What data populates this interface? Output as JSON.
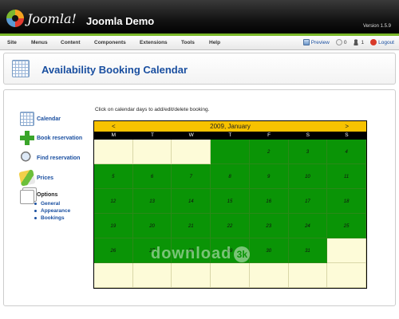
{
  "header": {
    "brand": "Joomla!",
    "site_title": "Joomla Demo",
    "version": "Version 1.5.9"
  },
  "menubar": {
    "items": [
      "Site",
      "Menus",
      "Content",
      "Components",
      "Extensions",
      "Tools",
      "Help"
    ],
    "status": {
      "preview": "Preview",
      "messages": "0",
      "users": "1",
      "logout": "Logout"
    }
  },
  "page": {
    "title": "Availability Booking Calendar"
  },
  "sidebar": {
    "items": [
      {
        "label": "Calendar",
        "icon": "calendar-icon"
      },
      {
        "label": "Book reservation",
        "icon": "plus-icon"
      },
      {
        "label": "Find reservation",
        "icon": "magnifier-icon"
      },
      {
        "label": "Prices",
        "icon": "price-tags-icon"
      }
    ],
    "options": {
      "label": "Options",
      "icon": "documents-icon",
      "subitems": [
        "General",
        "Appearance",
        "Bookings"
      ]
    }
  },
  "calendar": {
    "instruction": "Click on calendar days to add/edit/delete booking.",
    "prev": "<",
    "next": ">",
    "month_label": "2009, January",
    "weekdays": [
      "M",
      "T",
      "W",
      "T",
      "F",
      "S",
      "S"
    ],
    "available_color": "#0a9406",
    "empty_color": "#fdfbd8",
    "weeks": [
      [
        "",
        "",
        "",
        "",
        "2",
        "3",
        "4"
      ],
      [
        "5",
        "6",
        "7",
        "8",
        "9",
        "10",
        "11"
      ],
      [
        "12",
        "13",
        "14",
        "15",
        "16",
        "17",
        "18"
      ],
      [
        "19",
        "20",
        "21",
        "22",
        "23",
        "24",
        "25"
      ],
      [
        "26",
        "27",
        "28",
        "29",
        "30",
        "31",
        ""
      ],
      [
        "",
        "",
        "",
        "",
        "",
        "",
        ""
      ]
    ],
    "available_flags": [
      [
        false,
        false,
        false,
        true,
        true,
        true,
        true
      ],
      [
        true,
        true,
        true,
        true,
        true,
        true,
        true
      ],
      [
        true,
        true,
        true,
        true,
        true,
        true,
        true
      ],
      [
        true,
        true,
        true,
        true,
        true,
        true,
        true
      ],
      [
        true,
        true,
        true,
        true,
        true,
        true,
        false
      ],
      [
        false,
        false,
        false,
        false,
        false,
        false,
        false
      ]
    ]
  },
  "watermark": {
    "text": "download",
    "badge": "3k"
  }
}
